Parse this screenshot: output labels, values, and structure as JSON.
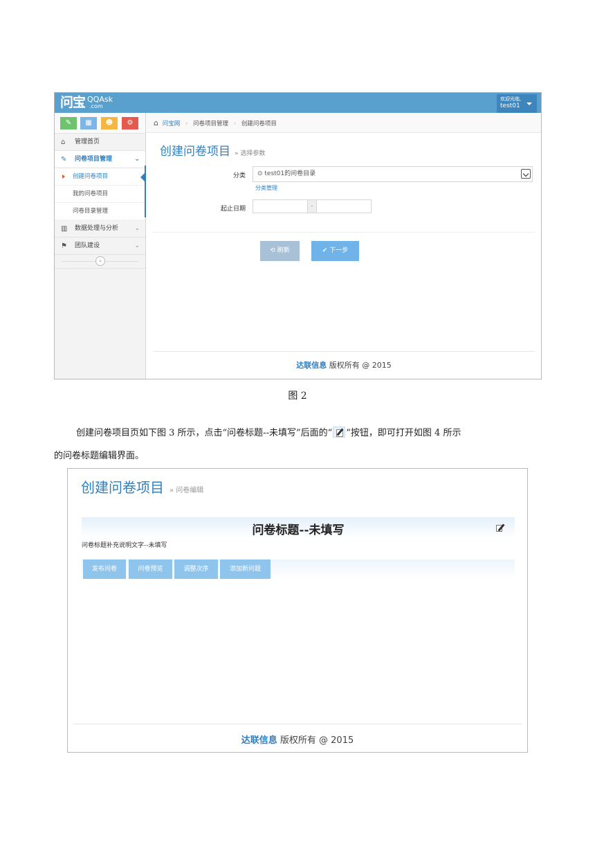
{
  "figure1": {
    "logo": {
      "main": "问宝",
      "suffix": "QQAsk",
      "sub": ".com"
    },
    "user": {
      "welcome": "欢迎光临,",
      "name": "test01"
    },
    "shortcut_colors": [
      "#6fc36f",
      "#7db6e6",
      "#f5b642",
      "#e45a4e"
    ],
    "nav": {
      "home": "管理首页",
      "survey_mgmt": "问卷项目管理",
      "sub_create": "创建问卷项目",
      "sub_mine": "我的问卷项目",
      "sub_dir": "问卷目录管理",
      "data": "数据处理与分析",
      "team": "团队建设",
      "collapse": "«"
    },
    "breadcrumb": {
      "root": "问宝网",
      "level1": "问卷项目管理",
      "level2": "创建问卷项目"
    },
    "title": "创建问卷项目",
    "subtitle": "» 选择参数",
    "form": {
      "category_label": "分类",
      "category_value": "⊙ test01的问卷目录",
      "category_link": "分类管理",
      "date_label": "起止日期",
      "date_sep": "-"
    },
    "buttons": {
      "refresh": "刷新",
      "next": "下一步"
    },
    "footer": {
      "brand": "达联信息",
      "text": "版权所有 @ 2015"
    }
  },
  "caption": "图 2",
  "paragraph": {
    "line1_a": "创建问卷项目页如下图 3 所示，点击“问卷标题--未填写”后面的“",
    "line1_b": "”按钮，即可打开如图 4 所示",
    "line2": "的问卷标题编辑界面。"
  },
  "figure2": {
    "title": "创建问卷项目",
    "subtitle": "» 问卷编辑",
    "survey_title": "问卷标题--未填写",
    "survey_desc": "问卷标题补充说明文字--未填写",
    "toolbar": [
      "发布问卷",
      "问卷预览",
      "调整次序",
      "添加新问题"
    ],
    "footer": {
      "brand": "达联信息",
      "text": "版权所有 @ 2015"
    }
  }
}
